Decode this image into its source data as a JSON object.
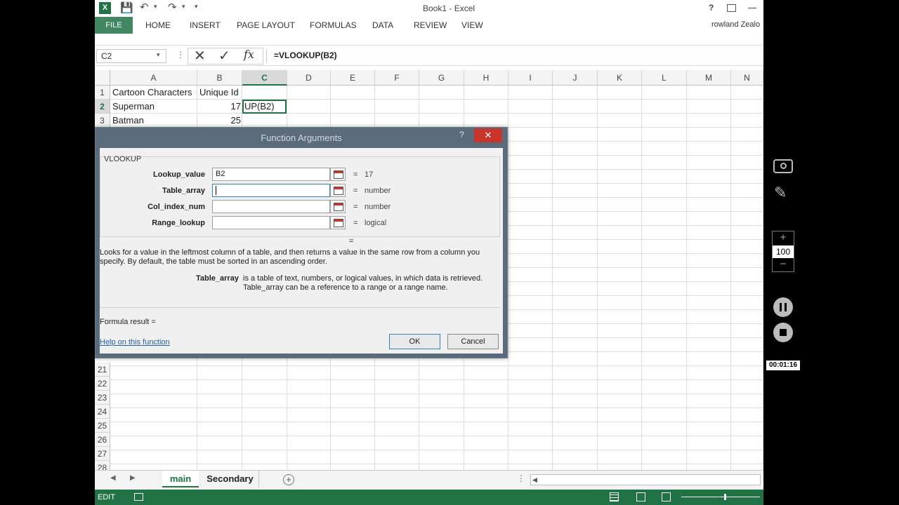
{
  "window": {
    "title": "Book1 - Excel",
    "user": "rowland Zealo",
    "help": "?",
    "close": "✕"
  },
  "ribbon": {
    "tabs": [
      "FILE",
      "HOME",
      "INSERT",
      "PAGE LAYOUT",
      "FORMULAS",
      "DATA",
      "REVIEW",
      "VIEW"
    ]
  },
  "formula_bar": {
    "name_box": "C2",
    "formula": "=VLOOKUP(B2)",
    "fx": "fx"
  },
  "columns": [
    "A",
    "B",
    "C",
    "D",
    "E",
    "F",
    "G",
    "H",
    "I",
    "J",
    "K",
    "L",
    "M",
    "N"
  ],
  "rows_top": [
    {
      "num": "1",
      "a": "Cartoon Characters",
      "b": "Unique Id",
      "c": ""
    },
    {
      "num": "2",
      "a": "Superman",
      "b": "17",
      "c": "UP(B2)"
    },
    {
      "num": "3",
      "a": "Batman",
      "b": "25",
      "c": ""
    }
  ],
  "rows_bottom": [
    "21",
    "22",
    "23",
    "24",
    "25",
    "26",
    "27",
    "28"
  ],
  "dialog": {
    "title": "Function Arguments",
    "help": "?",
    "close": "✕",
    "function_name": "VLOOKUP",
    "args": [
      {
        "label": "Lookup_value",
        "value": "B2",
        "eq": "=",
        "result": "17"
      },
      {
        "label": "Table_array",
        "value": "",
        "eq": "=",
        "result": "number"
      },
      {
        "label": "Col_index_num",
        "value": "",
        "eq": "=",
        "result": "number"
      },
      {
        "label": "Range_lookup",
        "value": "",
        "eq": "=",
        "result": "logical"
      }
    ],
    "overall_eq": "=",
    "description": "Looks for a value in the leftmost column of a table, and then returns a value in the same row from a column you specify. By default, the table must be sorted in an ascending order.",
    "arg_name": "Table_array",
    "arg_help_1": "is a table of text, numbers, or logical values, in which data is retrieved.",
    "arg_help_2": "Table_array can be a reference to a range or a range name.",
    "formula_result": "Formula result =",
    "help_link": "Help on this function",
    "ok": "OK",
    "cancel": "Cancel"
  },
  "sheets": {
    "tabs": [
      "main",
      "Secondary"
    ],
    "active": "main"
  },
  "status": {
    "mode": "EDIT"
  },
  "recorder": {
    "zoom": "100",
    "plus": "+",
    "minus": "−",
    "timer": "00:01:16"
  },
  "colors": {
    "excel_green": "#217346",
    "dialog_frame": "#5a6b7c",
    "close_red": "#c7352b"
  }
}
